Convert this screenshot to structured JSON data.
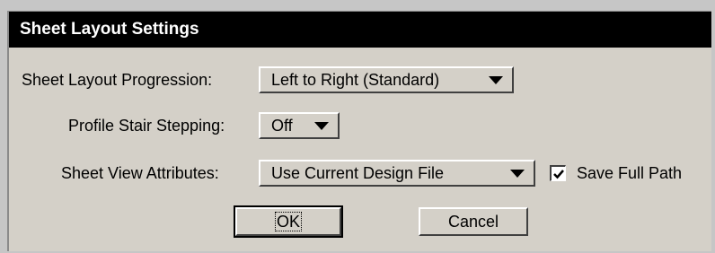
{
  "window": {
    "title": "Sheet Layout Settings"
  },
  "fields": {
    "progression": {
      "label": "Sheet Layout Progression:",
      "value": "Left to Right (Standard)"
    },
    "stair_stepping": {
      "label": "Profile Stair Stepping:",
      "value": "Off"
    },
    "view_attributes": {
      "label": "Sheet View Attributes:",
      "value": "Use Current Design File"
    },
    "save_full_path": {
      "label": "Save Full Path",
      "checked": true
    }
  },
  "buttons": {
    "ok_label": "OK",
    "cancel_label": "Cancel"
  },
  "icons": {
    "dropdown": "chevron-down-icon",
    "check": "check-icon"
  }
}
